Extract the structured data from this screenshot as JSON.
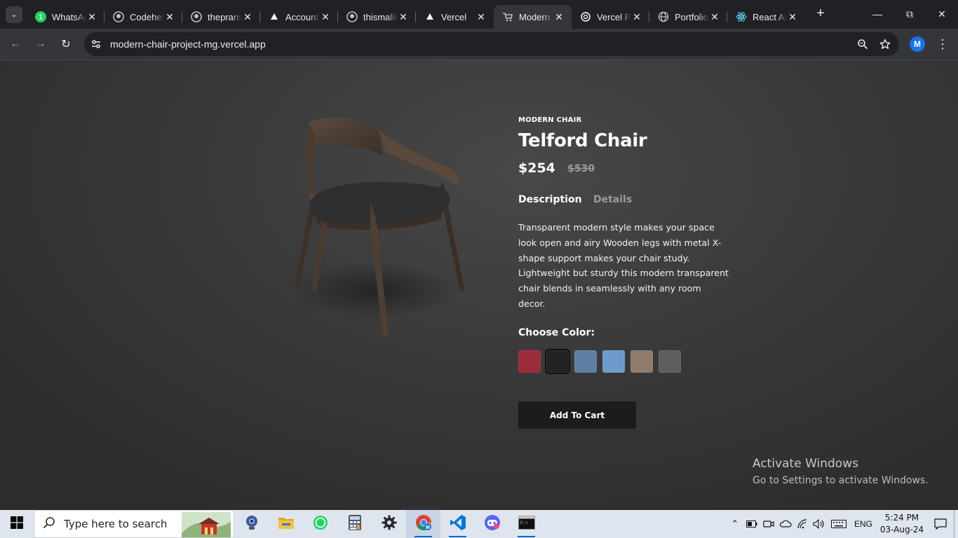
{
  "browser": {
    "tabs": [
      {
        "title": "WhatsApp",
        "icon": "whatsapp-icon"
      },
      {
        "title": "Codehelp",
        "icon": "github-icon"
      },
      {
        "title": "thepranshu",
        "icon": "github-icon"
      },
      {
        "title": "Account",
        "icon": "vercel-icon"
      },
      {
        "title": "thismalik",
        "icon": "github-icon"
      },
      {
        "title": "Vercel",
        "icon": "vercel-icon"
      },
      {
        "title": "Modern Chair",
        "icon": "cart-icon"
      },
      {
        "title": "Vercel Project",
        "icon": "openai-icon"
      },
      {
        "title": "Portfolio",
        "icon": "globe-icon"
      },
      {
        "title": "React App",
        "icon": "react-icon"
      }
    ],
    "whatsapp_badge": "1",
    "active_tab_index": 6,
    "url": "modern-chair-project-mg.vercel.app",
    "profile_initial": "M"
  },
  "product": {
    "category": "MODERN CHAIR",
    "name": "Telford Chair",
    "price": "$254",
    "old_price": "$530",
    "tabs": {
      "description": "Description",
      "details": "Details"
    },
    "description": "Transparent modern style makes your space look open and airy Wooden legs with metal X-shape support makes your chair study. Lightweight but sturdy this modern transparent chair blends in seamlessly with any room decor.",
    "choose_color_label": "Choose Color:",
    "colors": [
      {
        "name": "red",
        "hex": "#9c2b3a"
      },
      {
        "name": "black",
        "hex": "#222222"
      },
      {
        "name": "denim-blue",
        "hex": "#5e7fa3"
      },
      {
        "name": "light-blue",
        "hex": "#6d9ccc"
      },
      {
        "name": "beige",
        "hex": "#8f7a6c"
      },
      {
        "name": "grey",
        "hex": "#5d5f5f"
      }
    ],
    "selected_color_index": 1,
    "add_to_cart_label": "Add To Cart"
  },
  "watermark": {
    "title": "Activate Windows",
    "subtitle": "Go to Settings to activate Windows."
  },
  "taskbar": {
    "search_placeholder": "Type here to search",
    "apps": [
      "webcam-icon",
      "file-explorer-icon",
      "whatsapp-icon",
      "calculator-icon",
      "settings-icon",
      "chrome-icon",
      "vscode-icon",
      "discord-icon",
      "terminal-icon"
    ],
    "language": "ENG",
    "time": "5:24 PM",
    "date": "03-Aug-24"
  }
}
